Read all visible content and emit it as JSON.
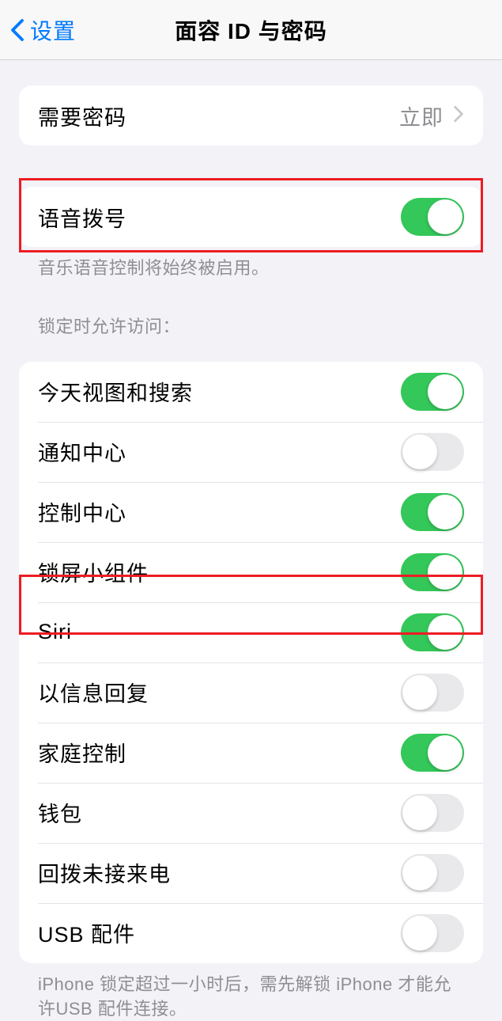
{
  "header": {
    "back_label": "设置",
    "title": "面容 ID 与密码"
  },
  "group1": {
    "require_passcode": {
      "label": "需要密码",
      "value": "立即"
    }
  },
  "group2": {
    "voice_dial": {
      "label": "语音拨号",
      "on": true
    },
    "footer": "音乐语音控制将始终被启用。"
  },
  "group3": {
    "header": "锁定时允许访问：",
    "items": [
      {
        "label": "今天视图和搜索",
        "on": true
      },
      {
        "label": "通知中心",
        "on": false
      },
      {
        "label": "控制中心",
        "on": true
      },
      {
        "label": "锁屏小组件",
        "on": true
      },
      {
        "label": "Siri",
        "on": true
      },
      {
        "label": "以信息回复",
        "on": false
      },
      {
        "label": "家庭控制",
        "on": true
      },
      {
        "label": "钱包",
        "on": false
      },
      {
        "label": "回拨未接来电",
        "on": false
      },
      {
        "label": "USB 配件",
        "on": false
      }
    ],
    "footer": "iPhone 锁定超过一小时后，需先解锁 iPhone 才能允许USB 配件连接。"
  }
}
